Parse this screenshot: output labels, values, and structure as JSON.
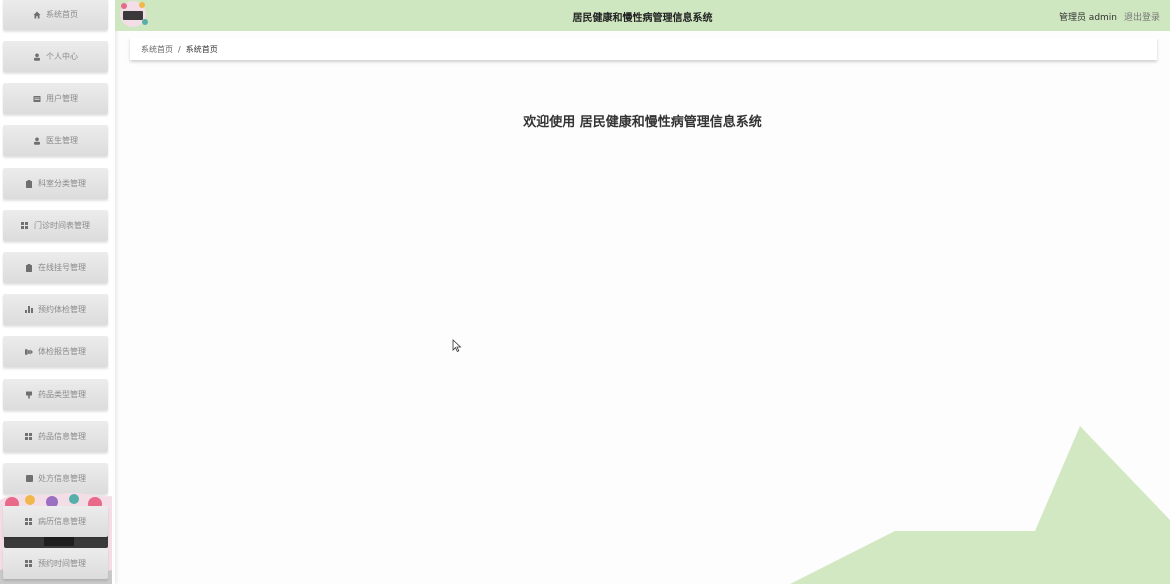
{
  "header": {
    "title": "居民健康和慢性病管理信息系统",
    "user_text": "管理员 admin",
    "logout_label": "退出登录"
  },
  "sidebar": {
    "items": [
      {
        "label": "系统首页",
        "icon": "home-icon"
      },
      {
        "label": "个人中心",
        "icon": "person-icon"
      },
      {
        "label": "用户管理",
        "icon": "users-icon"
      },
      {
        "label": "医生管理",
        "icon": "person-icon"
      },
      {
        "label": "科室分类管理",
        "icon": "clipboard-icon"
      },
      {
        "label": "门诊时间表管理",
        "icon": "grid-icon"
      },
      {
        "label": "在线挂号管理",
        "icon": "clipboard-icon"
      },
      {
        "label": "预约体检管理",
        "icon": "bar-chart-icon"
      },
      {
        "label": "体检报告管理",
        "icon": "report-icon"
      },
      {
        "label": "药品类型管理",
        "icon": "pill-icon"
      },
      {
        "label": "药品信息管理",
        "icon": "grid-icon"
      },
      {
        "label": "处方信息管理",
        "icon": "square-icon"
      },
      {
        "label": "病历信息管理",
        "icon": "grid-icon"
      },
      {
        "label": "预约时间管理",
        "icon": "grid-icon"
      }
    ]
  },
  "breadcrumb": {
    "home": "系统首页",
    "separator": "/",
    "current": "系统首页"
  },
  "main": {
    "welcome": "欢迎使用 居民健康和慢性病管理信息系统"
  },
  "colors": {
    "header_bg": "#cfe7c0",
    "accent_shape": "#d2e8c3"
  }
}
